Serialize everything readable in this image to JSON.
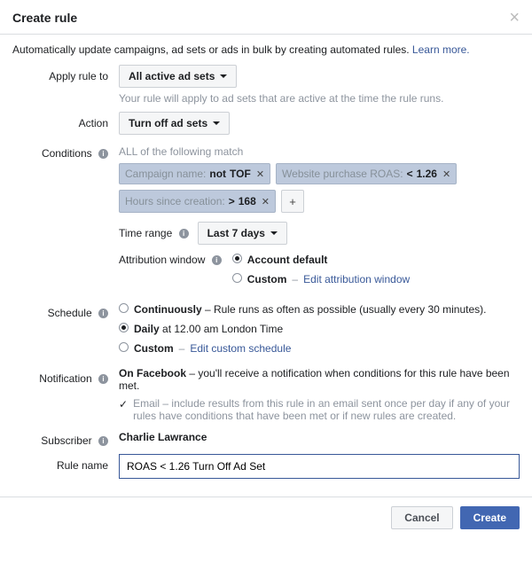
{
  "header": {
    "title": "Create rule"
  },
  "intro": {
    "text": "Automatically update campaigns, ad sets or ads in bulk by creating automated rules. ",
    "learn_more": "Learn more."
  },
  "apply": {
    "label": "Apply rule to",
    "value": "All active ad sets",
    "help": "Your rule will apply to ad sets that are active at the time the rule runs."
  },
  "action": {
    "label": "Action",
    "value": "Turn off ad sets"
  },
  "conditions": {
    "label": "Conditions",
    "header": "ALL of the following match",
    "chips": [
      {
        "field": "Campaign name:",
        "op": "not",
        "val": "TOF"
      },
      {
        "field": "Website purchase ROAS:",
        "op": "<",
        "val": "1.26"
      },
      {
        "field": "Hours since creation:",
        "op": ">",
        "val": "168"
      }
    ],
    "time_range_label": "Time range",
    "time_range_value": "Last 7 days",
    "attribution_label": "Attribution window",
    "attribution_opts": {
      "default": "Account default",
      "custom": "Custom",
      "custom_link": "Edit attribution window"
    }
  },
  "schedule": {
    "label": "Schedule",
    "continuous": {
      "title": "Continuously",
      "desc": " – Rule runs as often as possible (usually every 30 minutes)."
    },
    "daily": {
      "title": "Daily",
      "desc": " at 12.00 am London Time"
    },
    "custom": {
      "title": "Custom",
      "link": "Edit custom schedule"
    }
  },
  "notification": {
    "label": "Notification",
    "fb_title": "On Facebook",
    "fb_desc": " – you'll receive a notification when conditions for this rule have been met.",
    "email_title": "Email",
    "email_desc": " – include results from this rule in an email sent once per day if any of your rules have conditions that have been met or if new rules are created."
  },
  "subscriber": {
    "label": "Subscriber",
    "value": "Charlie Lawrance"
  },
  "rule_name": {
    "label": "Rule name",
    "value": "ROAS < 1.26 Turn Off Ad Set"
  },
  "footer": {
    "cancel": "Cancel",
    "create": "Create"
  }
}
